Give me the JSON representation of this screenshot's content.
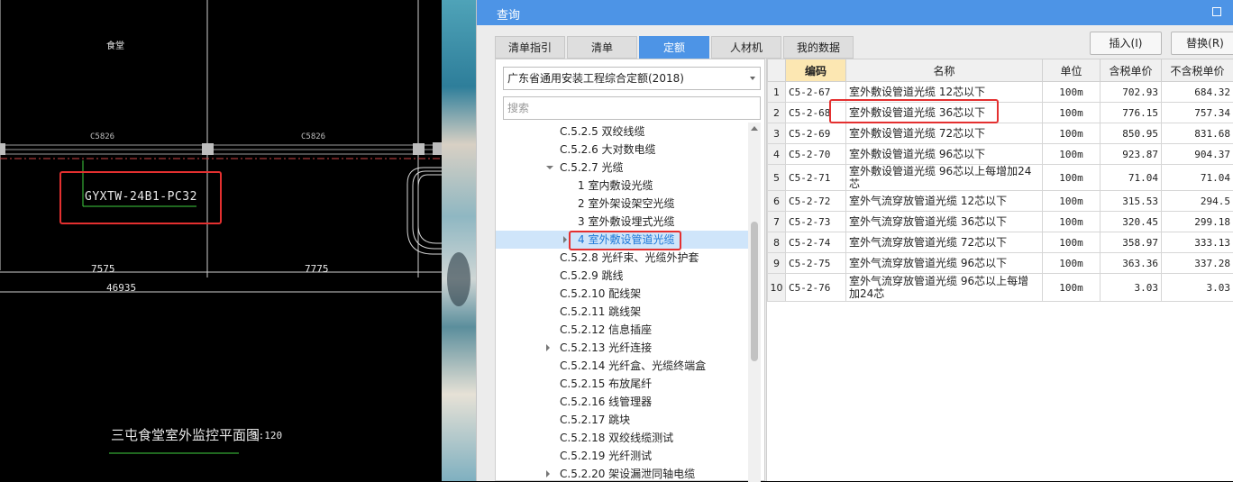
{
  "cad": {
    "canteen_label": "食堂",
    "dim_label_left": "C5826",
    "dim_label_right": "C5826",
    "cable_label": "GYXTW-24B1-PC32",
    "measure_left": "7575",
    "measure_right": "7775",
    "measure_total": "46935",
    "drawing_title": "三屯食堂室外监控平面图",
    "drawing_scale": "1:120"
  },
  "dialog": {
    "title": "查询",
    "tabs": [
      {
        "label": "清单指引"
      },
      {
        "label": "清单"
      },
      {
        "label": "定额",
        "active": true
      },
      {
        "label": "人材机"
      },
      {
        "label": "我的数据"
      }
    ],
    "insert_button": "插入(I)",
    "replace_button": "替换(R)",
    "quota_library": "广东省通用安装工程综合定额(2018)",
    "search_placeholder": "搜索"
  },
  "tree": [
    {
      "label": "C.5.2.5 双绞线缆",
      "level": 1
    },
    {
      "label": "C.5.2.6 大对数电缆",
      "level": 1
    },
    {
      "label": "C.5.2.7 光缆",
      "level": 1,
      "expanded": true
    },
    {
      "label": "1 室内敷设光缆",
      "level": 2
    },
    {
      "label": "2 室外架设架空光缆",
      "level": 2
    },
    {
      "label": "3 室外敷设埋式光缆",
      "level": 2
    },
    {
      "label": "4 室外敷设管道光缆",
      "level": 2,
      "selected": true,
      "collapsed": true
    },
    {
      "label": "C.5.2.8 光纤束、光缆外护套",
      "level": 1
    },
    {
      "label": "C.5.2.9 跳线",
      "level": 1
    },
    {
      "label": "C.5.2.10 配线架",
      "level": 1
    },
    {
      "label": "C.5.2.11 跳线架",
      "level": 1
    },
    {
      "label": "C.5.2.12 信息插座",
      "level": 1
    },
    {
      "label": "C.5.2.13 光纤连接",
      "level": 1,
      "collapsed": true
    },
    {
      "label": "C.5.2.14 光纤盒、光缆终端盒",
      "level": 1
    },
    {
      "label": "C.5.2.15 布放尾纤",
      "level": 1
    },
    {
      "label": "C.5.2.16 线管理器",
      "level": 1
    },
    {
      "label": "C.5.2.17 跳块",
      "level": 1
    },
    {
      "label": "C.5.2.18 双绞线缆测试",
      "level": 1
    },
    {
      "label": "C.5.2.19 光纤测试",
      "level": 1
    },
    {
      "label": "C.5.2.20 架设漏泄同轴电缆",
      "level": 1,
      "collapsed": true
    }
  ],
  "grid": {
    "headers": [
      "编码",
      "名称",
      "单位",
      "含税单价",
      "不含税单价"
    ],
    "rows": [
      {
        "n": "1",
        "code": "C5-2-67",
        "name": "室外敷设管道光缆 12芯以下",
        "unit": "100m",
        "tax": "702.93",
        "notax": "684.32"
      },
      {
        "n": "2",
        "code": "C5-2-68",
        "name": "室外敷设管道光缆 36芯以下",
        "unit": "100m",
        "tax": "776.15",
        "notax": "757.34"
      },
      {
        "n": "3",
        "code": "C5-2-69",
        "name": "室外敷设管道光缆 72芯以下",
        "unit": "100m",
        "tax": "850.95",
        "notax": "831.68"
      },
      {
        "n": "4",
        "code": "C5-2-70",
        "name": "室外敷设管道光缆 96芯以下",
        "unit": "100m",
        "tax": "923.87",
        "notax": "904.37"
      },
      {
        "n": "5",
        "code": "C5-2-71",
        "name": "室外敷设管道光缆 96芯以上每增加24芯",
        "unit": "100m",
        "tax": "71.04",
        "notax": "71.04"
      },
      {
        "n": "6",
        "code": "C5-2-72",
        "name": "室外气流穿放管道光缆 12芯以下",
        "unit": "100m",
        "tax": "315.53",
        "notax": "294.5"
      },
      {
        "n": "7",
        "code": "C5-2-73",
        "name": "室外气流穿放管道光缆 36芯以下",
        "unit": "100m",
        "tax": "320.45",
        "notax": "299.18"
      },
      {
        "n": "8",
        "code": "C5-2-74",
        "name": "室外气流穿放管道光缆 72芯以下",
        "unit": "100m",
        "tax": "358.97",
        "notax": "333.13"
      },
      {
        "n": "9",
        "code": "C5-2-75",
        "name": "室外气流穿放管道光缆 96芯以下",
        "unit": "100m",
        "tax": "363.36",
        "notax": "337.28"
      },
      {
        "n": "10",
        "code": "C5-2-76",
        "name": "室外气流穿放管道光缆 96芯以上每增加24芯",
        "unit": "100m",
        "tax": "3.03",
        "notax": "3.03"
      }
    ]
  }
}
